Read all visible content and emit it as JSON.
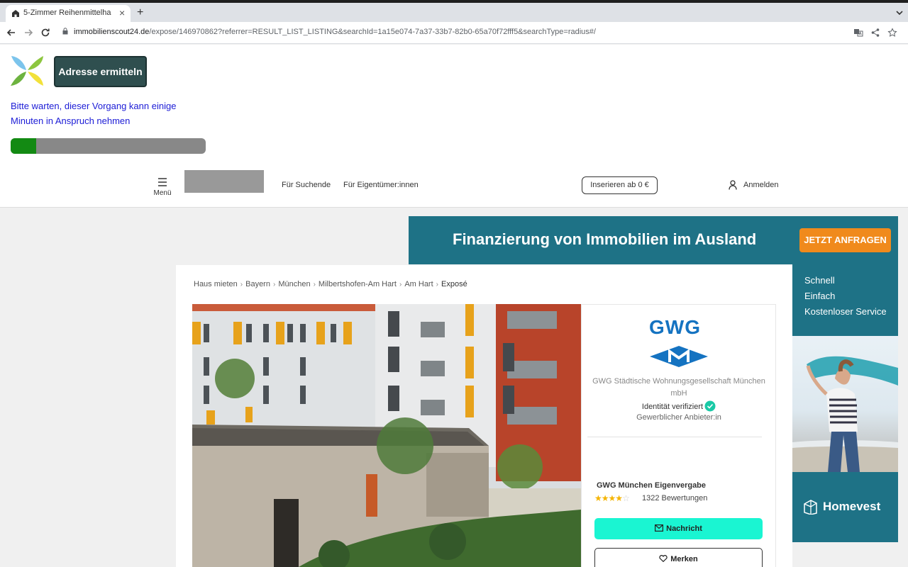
{
  "browser": {
    "tab_title": "5-Zimmer Reihenmittelha",
    "new_tab": "+",
    "url_host": "immobilienscout24.de",
    "url_path": "/expose/146970862?referrer=RESULT_LIST_LISTING&searchId=1a15e074-7a37-33b7-82b0-65a70f72fff5&searchType=radius#/"
  },
  "extension": {
    "button_label": "Adresse ermitteln",
    "message": "Bitte warten, dieser Vorgang kann einige Minuten in Anspruch nehmen",
    "progress": 0.13
  },
  "header": {
    "menu_label": "Menü",
    "nav": [
      "Für Suchende",
      "Für Eigentümer:innen"
    ],
    "insert_button": "Inserieren ab 0 €",
    "login": "Anmelden"
  },
  "ad": {
    "headline": "Finanzierung von Immobilien im Ausland",
    "cta": "JETZT ANFRAGEN",
    "features": [
      "Schnell",
      "Einfach",
      "Kostenloser Service"
    ],
    "brand": "Homevest",
    "colors": {
      "teal": "#1e7286",
      "orange": "#f08a1c"
    }
  },
  "breadcrumb": [
    "Haus mieten",
    "Bayern",
    "München",
    "Milbertshofen-Am Hart",
    "Am Hart",
    "Exposé"
  ],
  "contact": {
    "logo_text": "GWG",
    "company": "GWG Städtische Wohnungsgesellschaft München mbH",
    "verified": "Identität verifiziert",
    "provider_type": "Gewerblicher Anbieter:in",
    "agency": "GWG München Eigenvergabe",
    "rating": 4,
    "rating_max": 5,
    "reviews": "1322 Bewertungen",
    "message_button": "Nachricht",
    "save_button": "Merken",
    "accent_color": "#1af5d2"
  }
}
